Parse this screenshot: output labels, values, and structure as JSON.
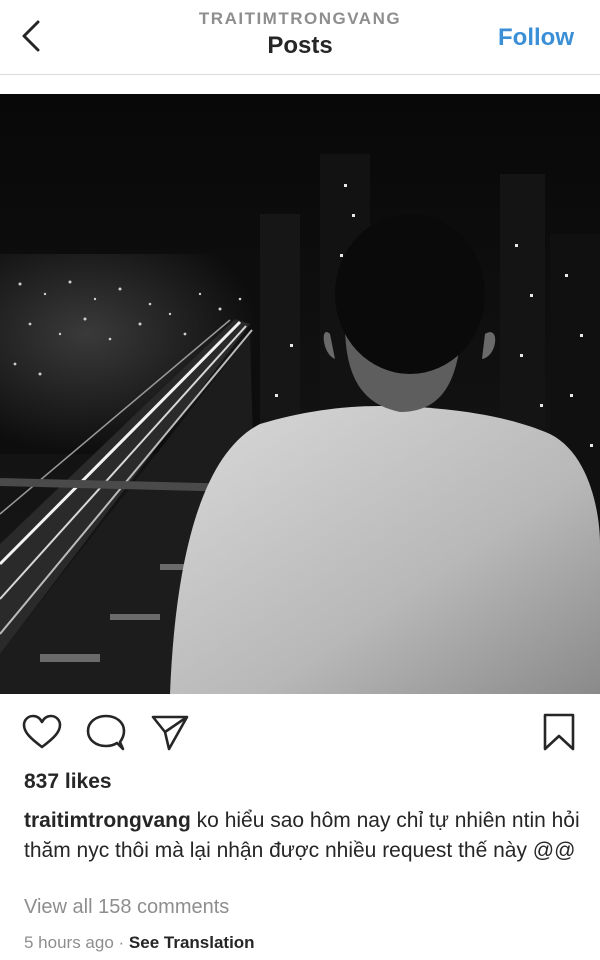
{
  "header": {
    "username": "TRAITIMTRONGVANG",
    "title": "Posts",
    "follow_label": "Follow"
  },
  "icons": {
    "back": "chevron-left-icon",
    "like": "heart-icon",
    "comment": "comment-icon",
    "share": "paper-plane-icon",
    "save": "bookmark-icon"
  },
  "post": {
    "likes": "837 likes",
    "caption_user": "traitimtrongvang",
    "caption_text": " ko hiểu sao hôm nay chỉ tự nhiên ntin hỏi thăm nyc thôi mà lại nhận được nhiều request thế này @@",
    "view_comments": "View all 158 comments",
    "timestamp": "5 hours ago",
    "separator": " · ",
    "see_translation": "See Translation"
  },
  "colors": {
    "accent": "#3b8fd6",
    "muted": "#8e8e8e",
    "text": "#262626"
  }
}
